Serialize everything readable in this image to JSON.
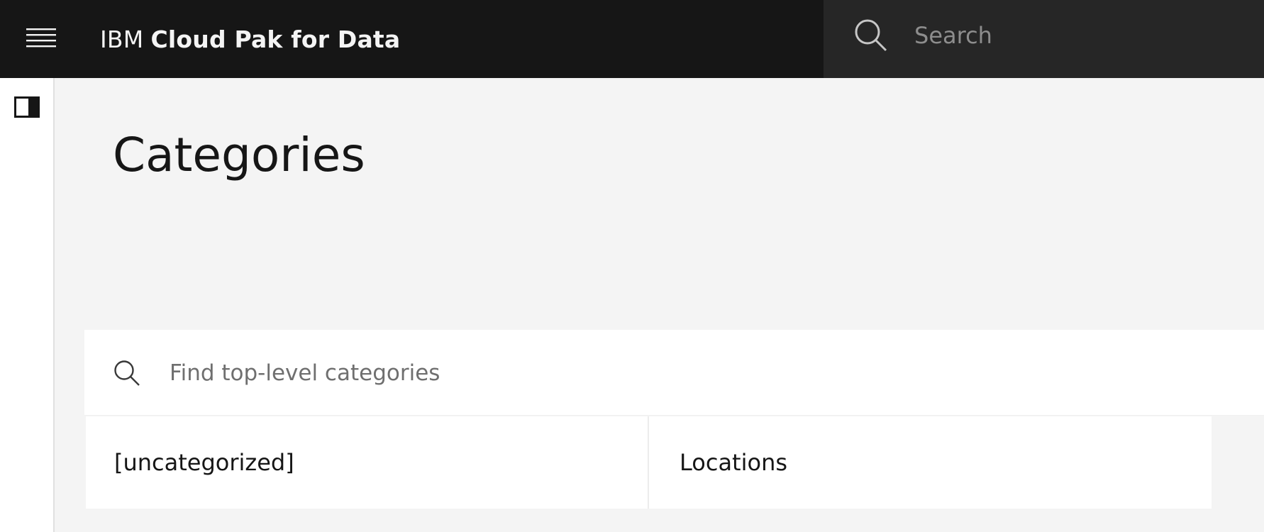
{
  "header": {
    "brand_prefix": "IBM",
    "brand_product": "Cloud Pak for Data",
    "search_placeholder": "Search",
    "menu_icon": "hamburger-menu-icon",
    "search_icon": "search-icon"
  },
  "sidebar": {
    "toggle_icon": "side-panel-toggle-icon"
  },
  "main": {
    "title": "Categories",
    "find": {
      "placeholder": "Find top-level categories",
      "icon": "search-icon"
    },
    "categories": [
      {
        "label": "[uncategorized]"
      },
      {
        "label": "Locations"
      }
    ]
  },
  "colors": {
    "header_bg": "#161616",
    "search_bg": "#262626",
    "page_bg": "#f4f4f4",
    "tile_bg": "#ffffff",
    "text": "#161616"
  }
}
